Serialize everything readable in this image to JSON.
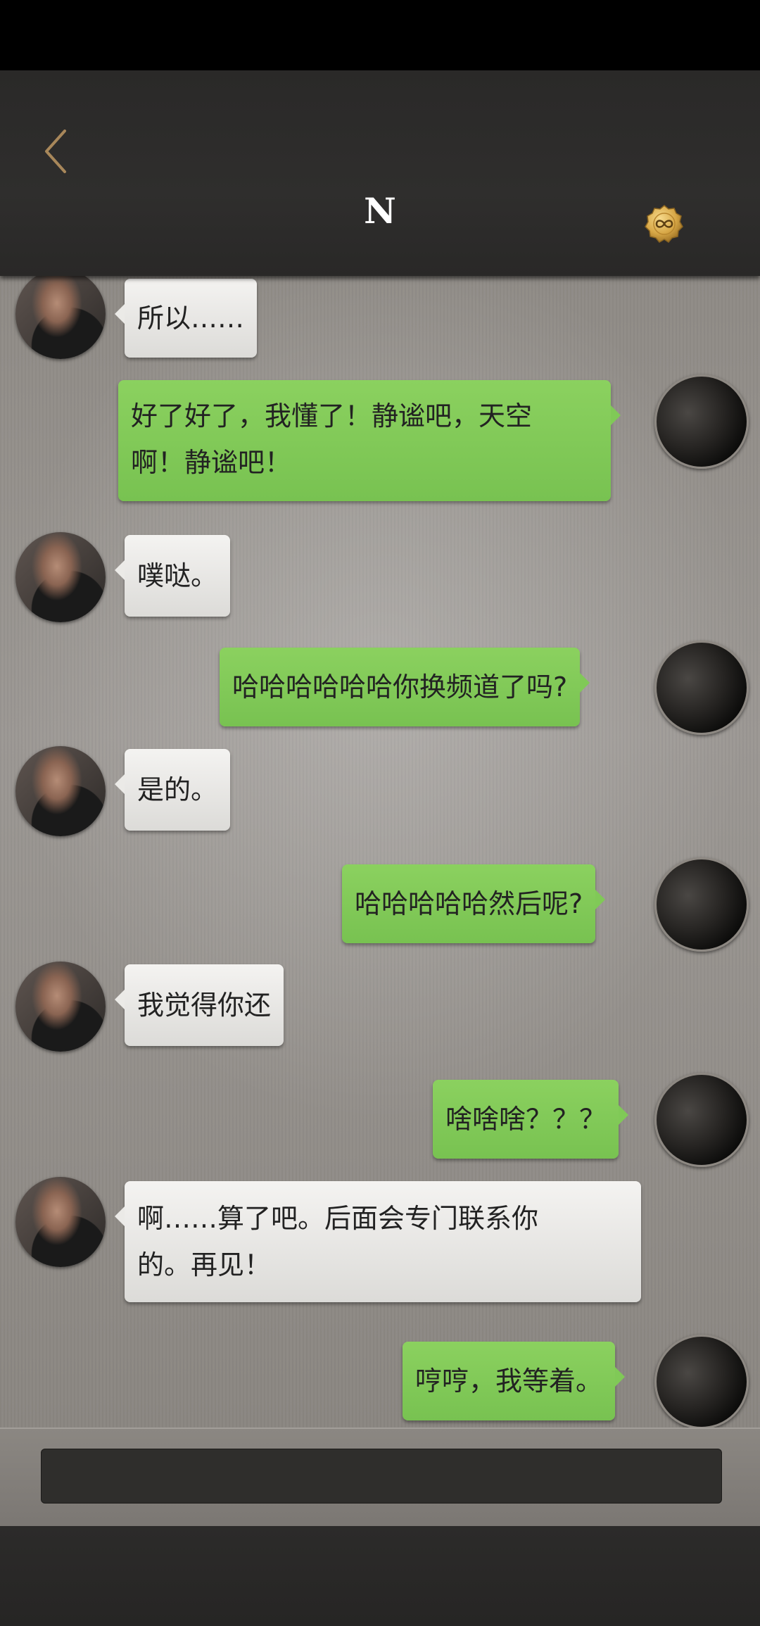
{
  "header": {
    "title": "N",
    "back_icon": "chevron-left-icon",
    "coin_icon": "infinity-coin-icon",
    "accent_color": "#a8875a"
  },
  "messages": [
    {
      "side": "left",
      "text": "所以……"
    },
    {
      "side": "right",
      "text": "好了好了，我懂了！静谧吧，天空\n啊！静谧吧！"
    },
    {
      "side": "left",
      "text": "噗哒。"
    },
    {
      "side": "right",
      "text": "哈哈哈哈哈哈你换频道了吗?"
    },
    {
      "side": "left",
      "text": "是的。"
    },
    {
      "side": "right",
      "text": "哈哈哈哈哈然后呢?"
    },
    {
      "side": "left",
      "text": "我觉得你还"
    },
    {
      "side": "right",
      "text": "啥啥啥？？？"
    },
    {
      "side": "left",
      "text": "啊……算了吧。后面会专门联系你\n的。再见！"
    },
    {
      "side": "right",
      "text": "哼哼，我等着。"
    }
  ],
  "input": {
    "placeholder": ""
  }
}
